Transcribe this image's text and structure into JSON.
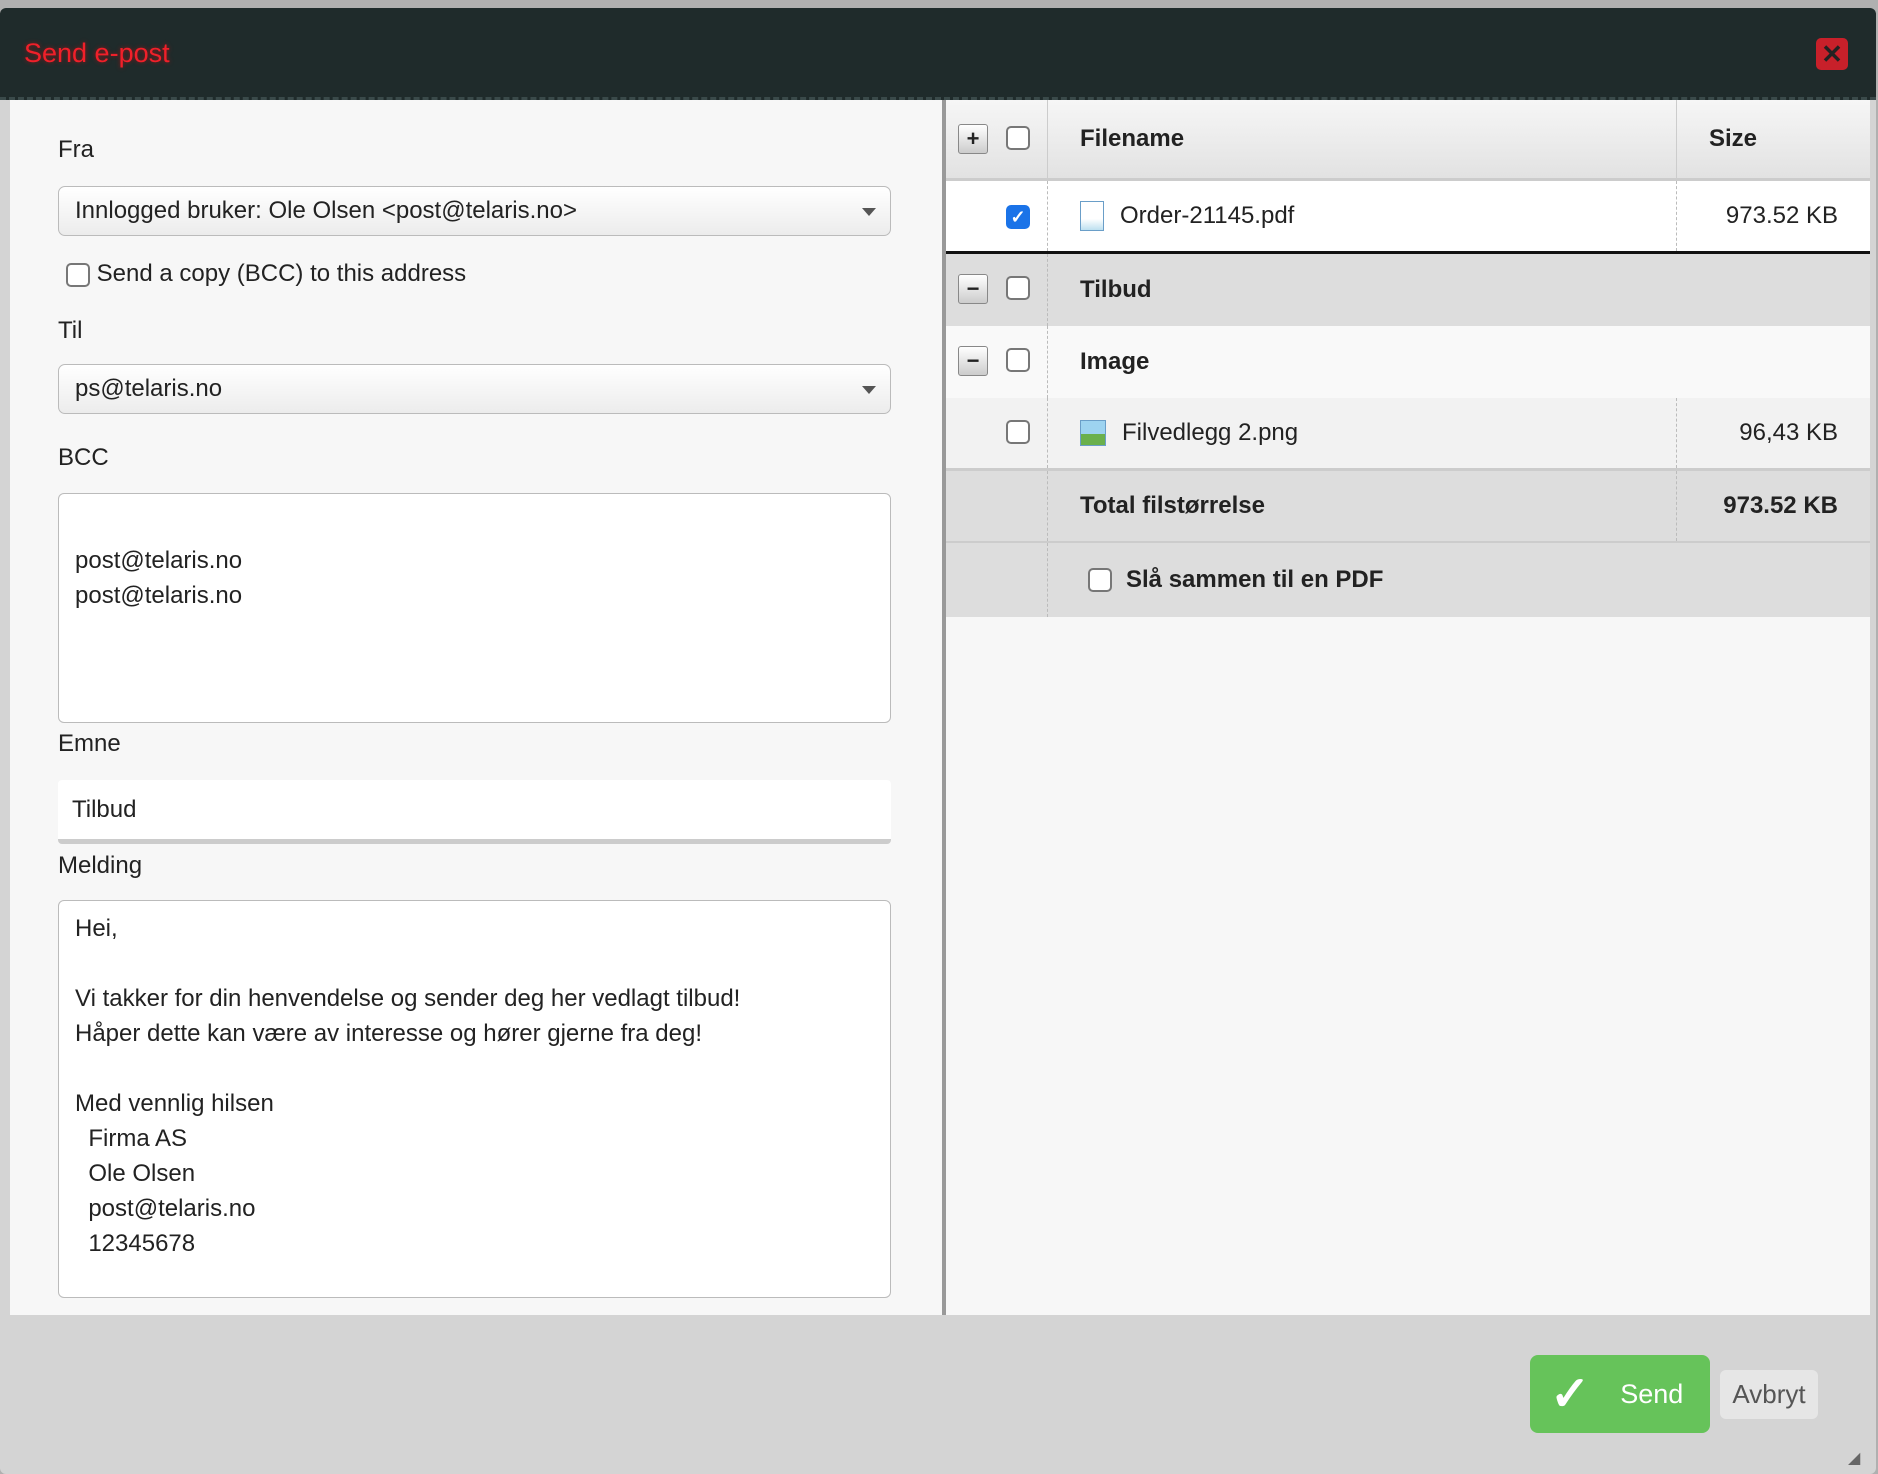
{
  "dialog": {
    "title": "Send e-post",
    "close_icon": "close-icon"
  },
  "form": {
    "from_label": "Fra",
    "from_value": "Innlogged bruker: Ole Olsen <post@telaris.no>",
    "bcc_copy_label": "Send a copy (BCC) to this address",
    "bcc_copy_checked": false,
    "to_label": "Til",
    "to_value": "ps@telaris.no",
    "bcc_label": "BCC",
    "bcc_value": "\npost@telaris.no\npost@telaris.no",
    "subject_label": "Emne",
    "subject_value": "Tilbud",
    "message_label": "Melding",
    "message_value": "Hei,\n\nVi takker for din henvendelse og sender deg her vedlagt tilbud!\nHåper dette kan være av interesse og hører gjerne fra deg!\n\nMed vennlig hilsen\n  Firma AS\n  Ole Olsen\n  post@telaris.no\n  12345678"
  },
  "attachments": {
    "header": {
      "filename": "Filename",
      "size": "Size"
    },
    "files": [
      {
        "name": "Order-21145.pdf",
        "size": "973.52 KB",
        "checked": true
      }
    ],
    "groups": [
      {
        "name": "Tilbud"
      },
      {
        "name": "Image",
        "files": [
          {
            "name": "Filvedlegg 2.png",
            "size": "96,43 KB",
            "checked": false
          }
        ]
      }
    ],
    "total_label": "Total filstørrelse",
    "total_value": "973.52 KB",
    "merge_label": "Slå sammen til en PDF"
  },
  "footer": {
    "send_label": "Send",
    "cancel_label": "Avbryt",
    "send_color": "#66c35a"
  }
}
